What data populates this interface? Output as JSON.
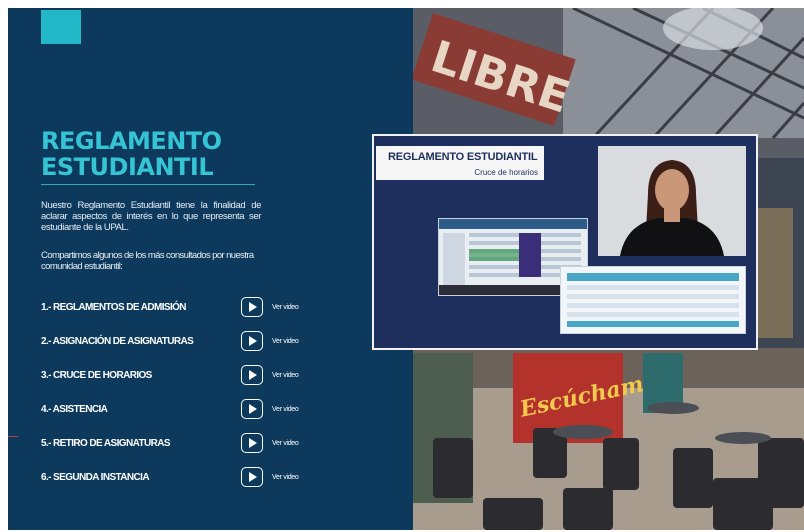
{
  "slide": {
    "title": "REGLAMENTO ESTUDIANTIL",
    "intro": "Nuestro Reglamento Estudiantil tiene la finalidad de aclarar aspectos de interés en lo que representa ser estudiante de la UPAL.",
    "intro2": "Compartimos algunos de los más consultados por nuestra comunidad estudiantil:",
    "topics": [
      {
        "label": "1.- REGLAMENTOS DE ADMISIÓN",
        "link": "Ver video"
      },
      {
        "label": "2.- ASIGNACIÓN DE ASIGNATURAS",
        "link": "Ver video"
      },
      {
        "label": "3.- CRUCE DE HORARIOS",
        "link": "Ver video"
      },
      {
        "label": "4.- ASISTENCIA",
        "link": "Ver video"
      },
      {
        "label": "5.- RETIRO DE ASIGNATURAS",
        "link": "Ver video"
      },
      {
        "label": "6.- SEGUNDA INSTANCIA",
        "link": "Ver video"
      }
    ]
  },
  "photo": {
    "sign_text": "LIBRE",
    "mural_text": "Escúchame"
  },
  "video_card": {
    "title": "REGLAMENTO ESTUDIANTIL",
    "subtitle": "Cruce de horarios"
  },
  "colors": {
    "background": "#0d3a5c",
    "accent": "#22b8c7",
    "title": "#34c4d4",
    "card": "#1e2f5e"
  },
  "icons": {
    "play": "play-icon"
  }
}
